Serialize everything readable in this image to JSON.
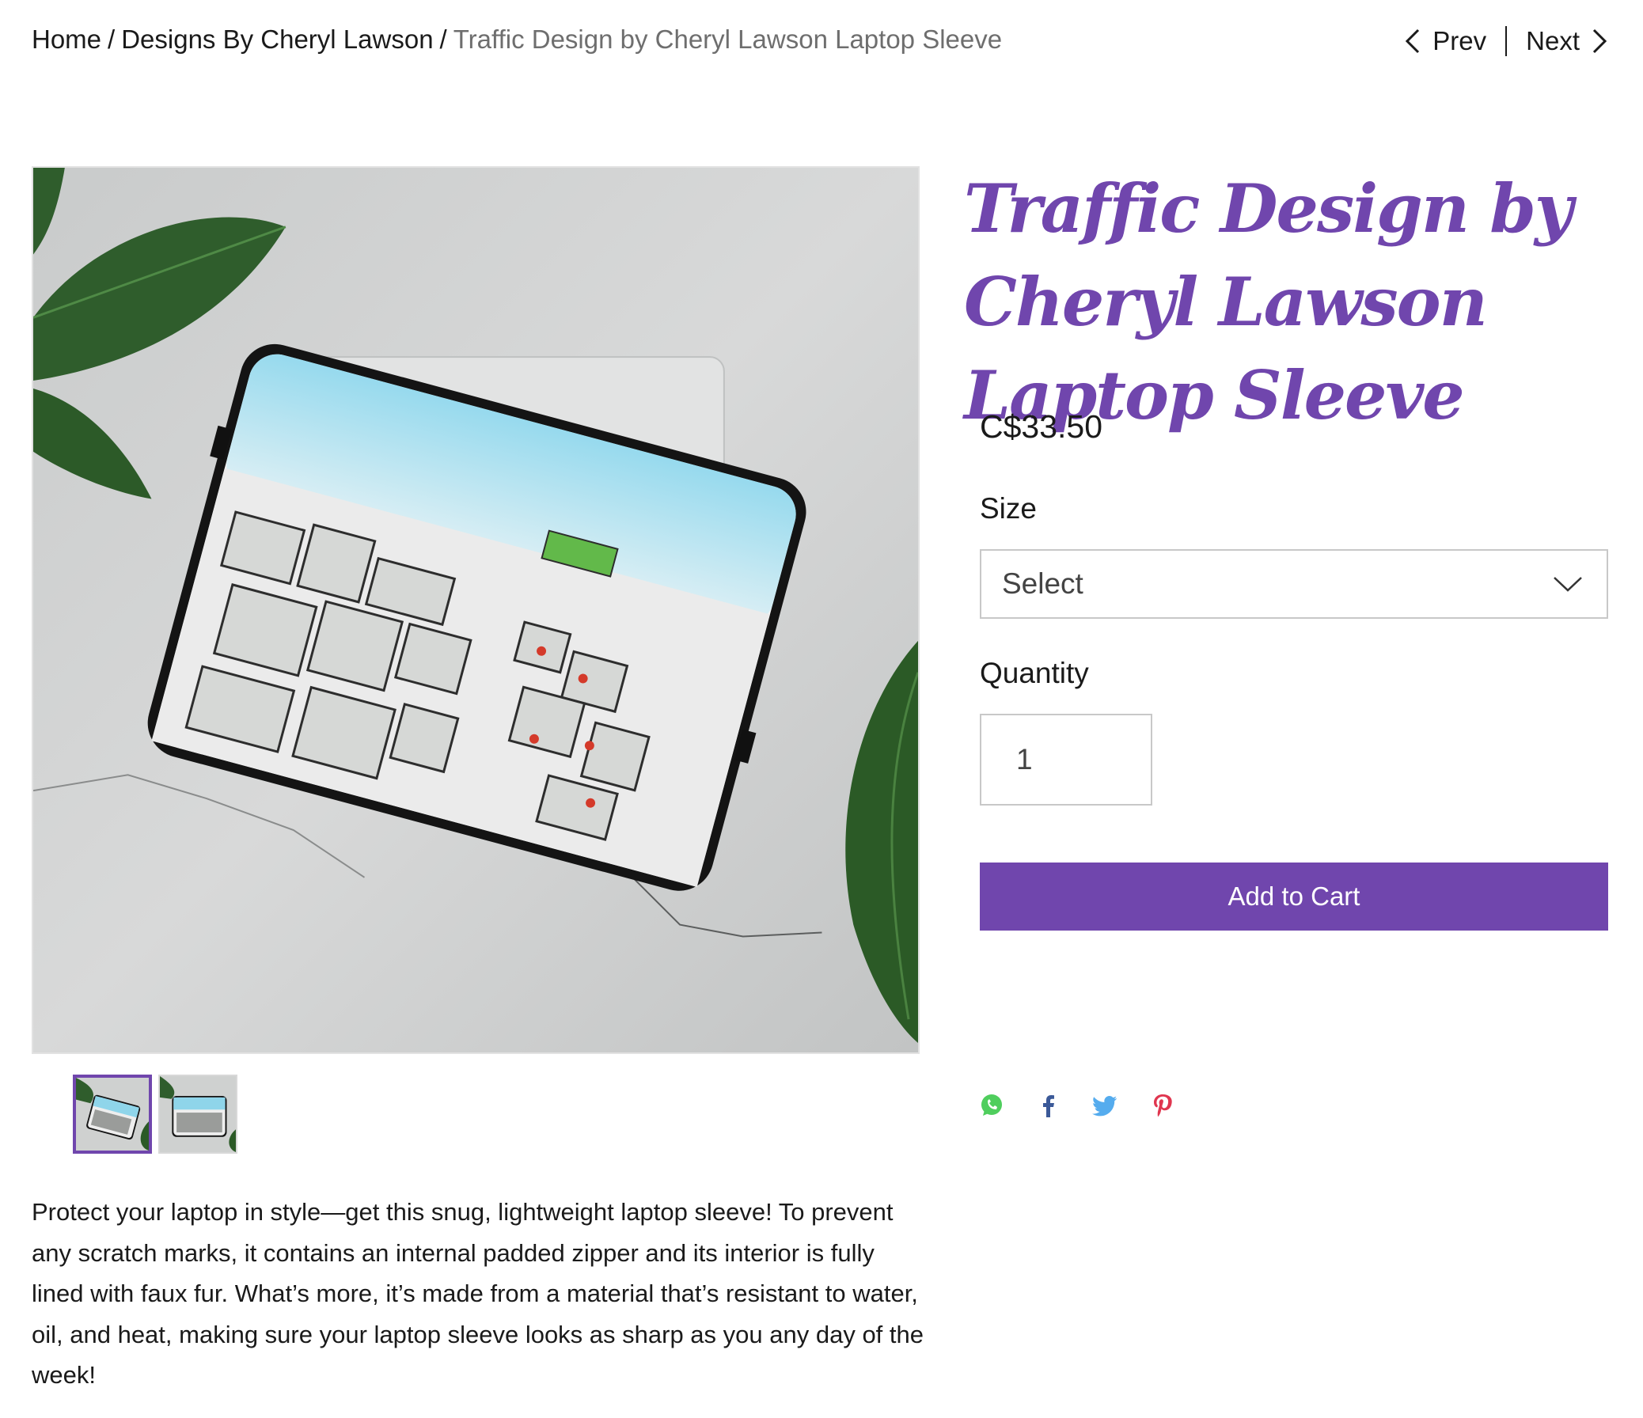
{
  "breadcrumb": {
    "home": "Home",
    "category": "Designs By Cheryl Lawson",
    "current": "Traffic Design by Cheryl Lawson Laptop Sleeve",
    "separator": "/"
  },
  "pager": {
    "prev_label": "Prev",
    "next_label": "Next"
  },
  "product": {
    "title": "Traffic Design by Cheryl Lawson Laptop Sleeve",
    "price": "C$33.50",
    "size_label": "Size",
    "size_value": "Select",
    "quantity_label": "Quantity",
    "quantity_value": "1",
    "add_to_cart": "Add to Cart",
    "description": "Protect your laptop in style—get this snug, lightweight laptop sleeve! To prevent any scratch marks, it contains an internal padded zipper and its interior is fully lined with faux fur. What’s more, it’s made from a material that’s resistant to water, oil, and heat, making sure your laptop sleeve looks as sharp as you any day of the week!"
  },
  "thumbnails": [
    {
      "name": "thumbnail-1",
      "active": true
    },
    {
      "name": "thumbnail-2",
      "active": false
    }
  ],
  "share_icons": [
    "whatsapp-icon",
    "facebook-icon",
    "twitter-icon",
    "pinterest-icon"
  ],
  "colors": {
    "accent": "#7046ad",
    "whatsapp": "#4fce5d",
    "facebook": "#3b5998",
    "twitter": "#55acee",
    "pinterest": "#e0364f"
  }
}
